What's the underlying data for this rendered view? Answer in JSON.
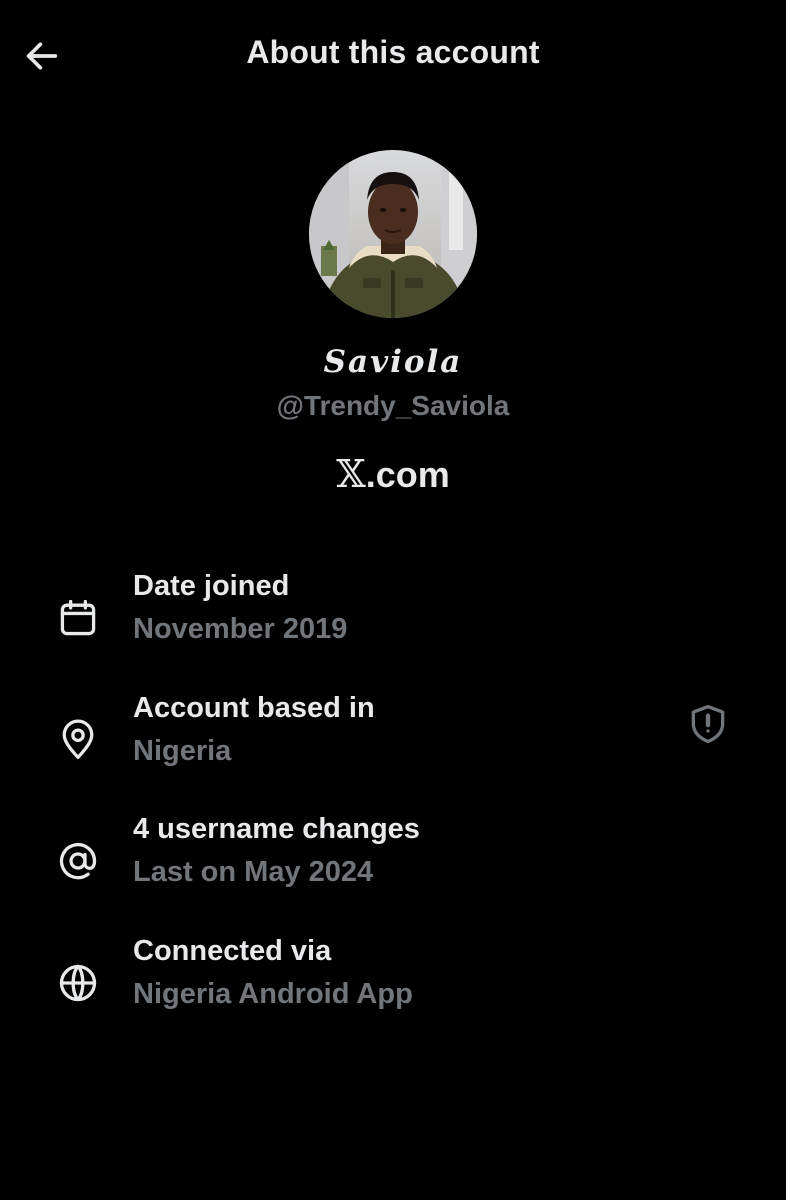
{
  "header": {
    "title": "About this account",
    "back_icon": "arrow-left-icon"
  },
  "profile": {
    "display_name": "Saviola",
    "handle": "@Trendy_Saviola",
    "site_glyph": "𝕏",
    "site_suffix": ".com"
  },
  "details": [
    {
      "icon": "calendar-icon",
      "label": "Date joined",
      "value": "November 2019"
    },
    {
      "icon": "location-pin-icon",
      "label": "Account based in",
      "value": "Nigeria",
      "trailing_icon": "shield-alert-icon"
    },
    {
      "icon": "at-sign-icon",
      "label": "4 username changes",
      "value": "Last on May 2024"
    },
    {
      "icon": "globe-icon",
      "label": "Connected via",
      "value": "Nigeria Android App"
    }
  ],
  "colors": {
    "background": "#000000",
    "primary_text": "#e7e9ea",
    "secondary_text": "#71767b"
  }
}
